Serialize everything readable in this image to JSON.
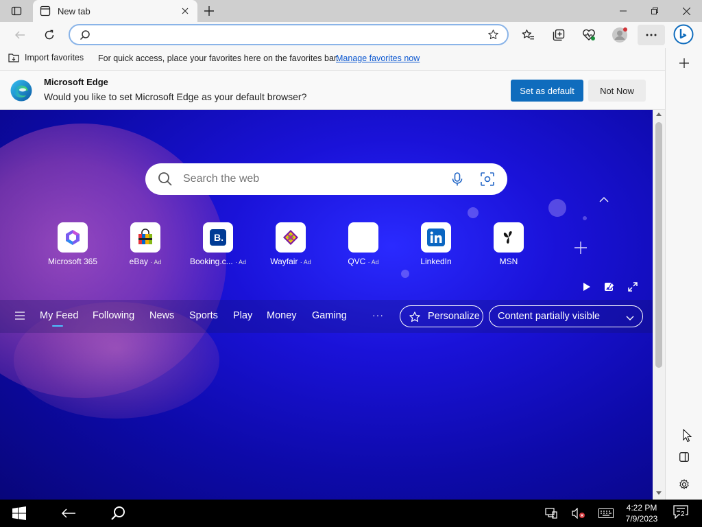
{
  "window": {
    "tab_title": "New tab"
  },
  "addressbar": {
    "value": "",
    "placeholder": ""
  },
  "favorites_bar": {
    "import_label": "Import favorites",
    "message": "For quick access, place your favorites here on the favorites bar.",
    "manage_link": "Manage favorites now"
  },
  "banner": {
    "title": "Microsoft Edge",
    "question": "Would you like to set Microsoft Edge as your default browser?",
    "set_default": "Set as default",
    "not_now": "Not Now"
  },
  "newtab": {
    "search_placeholder": "Search the web",
    "tiles": [
      {
        "name": "Microsoft 365",
        "ad": ""
      },
      {
        "name": "eBay",
        "ad": "· Ad"
      },
      {
        "name": "Booking.c...",
        "ad": "· Ad"
      },
      {
        "name": "Wayfair",
        "ad": "· Ad"
      },
      {
        "name": "QVC",
        "ad": "· Ad"
      },
      {
        "name": "LinkedIn",
        "ad": ""
      },
      {
        "name": "MSN",
        "ad": ""
      }
    ],
    "feed_nav": [
      "My Feed",
      "Following",
      "News",
      "Sports",
      "Play",
      "Money",
      "Gaming"
    ],
    "more": "···",
    "personalize": "Personalize",
    "content_visibility": "Content partially visible"
  },
  "taskbar": {
    "time": "4:22 PM",
    "date": "7/9/2023",
    "notification_count": "2"
  },
  "colors": {
    "accent": "#0f6cbd",
    "link": "#0b57d0",
    "feed_active": "#4cc2ff",
    "background_deep": "#0d0aa8"
  }
}
